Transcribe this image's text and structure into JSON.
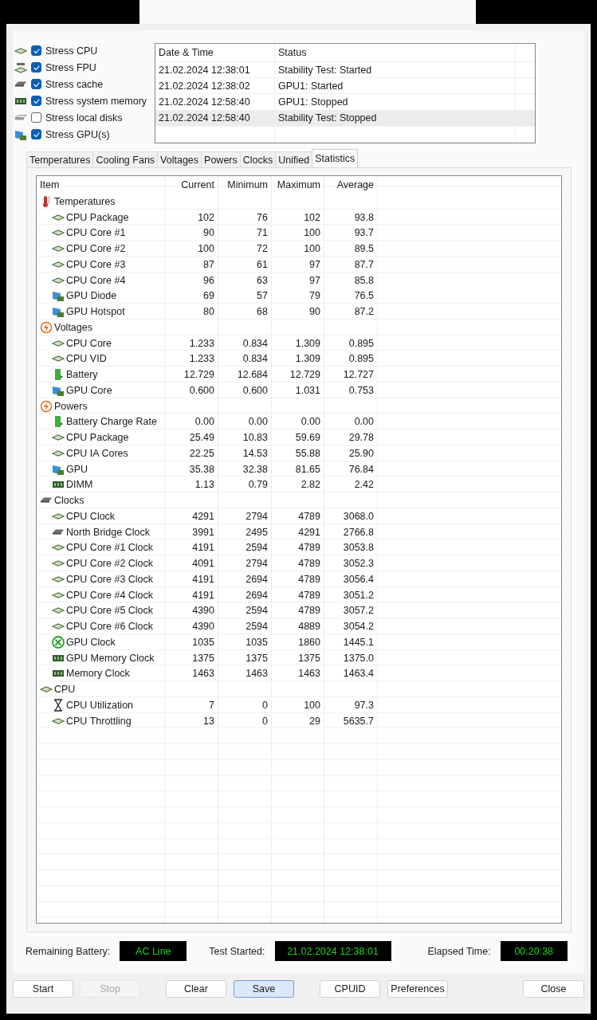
{
  "stress_options": [
    {
      "label": "Stress CPU",
      "checked": true,
      "kind": "cpu"
    },
    {
      "label": "Stress FPU",
      "checked": true,
      "kind": "fpu"
    },
    {
      "label": "Stress cache",
      "checked": true,
      "kind": "cache"
    },
    {
      "label": "Stress system memory",
      "checked": true,
      "kind": "dimm"
    },
    {
      "label": "Stress local disks",
      "checked": false,
      "kind": "disk"
    },
    {
      "label": "Stress GPU(s)",
      "checked": true,
      "kind": "gpu"
    }
  ],
  "log": {
    "columns": [
      "Date & Time",
      "Status"
    ],
    "rows": [
      {
        "time": "21.02.2024 12:38:01",
        "status": "Stability Test: Started",
        "selected": false
      },
      {
        "time": "21.02.2024 12:38:02",
        "status": "GPU1: Started",
        "selected": false
      },
      {
        "time": "21.02.2024 12:58:40",
        "status": "GPU1: Stopped",
        "selected": false
      },
      {
        "time": "21.02.2024 12:58:40",
        "status": "Stability Test: Stopped",
        "selected": true
      }
    ]
  },
  "tabs": [
    {
      "label": "Temperatures",
      "selected": false
    },
    {
      "label": "Cooling Fans",
      "selected": false
    },
    {
      "label": "Voltages",
      "selected": false
    },
    {
      "label": "Powers",
      "selected": false
    },
    {
      "label": "Clocks",
      "selected": false
    },
    {
      "label": "Unified",
      "selected": false
    },
    {
      "label": "Statistics",
      "selected": true
    }
  ],
  "statistics": {
    "columns": [
      "Item",
      "Current",
      "Minimum",
      "Maximum",
      "Average"
    ],
    "groups": [
      {
        "name": "Temperatures",
        "kind": "thermometer",
        "children": [
          {
            "name": "CPU Package",
            "kind": "cpu",
            "values": [
              "102",
              "76",
              "102",
              "93.8"
            ]
          },
          {
            "name": "CPU Core #1",
            "kind": "cpu",
            "values": [
              "90",
              "71",
              "100",
              "93.7"
            ]
          },
          {
            "name": "CPU Core #2",
            "kind": "cpu",
            "values": [
              "100",
              "72",
              "100",
              "89.5"
            ]
          },
          {
            "name": "CPU Core #3",
            "kind": "cpu",
            "values": [
              "87",
              "61",
              "97",
              "87.7"
            ]
          },
          {
            "name": "CPU Core #4",
            "kind": "cpu",
            "values": [
              "96",
              "63",
              "97",
              "85.8"
            ]
          },
          {
            "name": "GPU Diode",
            "kind": "gpu",
            "values": [
              "69",
              "57",
              "79",
              "76.5"
            ]
          },
          {
            "name": "GPU Hotspot",
            "kind": "gpu",
            "values": [
              "80",
              "68",
              "90",
              "87.2"
            ]
          }
        ]
      },
      {
        "name": "Voltages",
        "kind": "bolt",
        "children": [
          {
            "name": "CPU Core",
            "kind": "cpu",
            "values": [
              "1.233",
              "0.834",
              "1.309",
              "0.895"
            ]
          },
          {
            "name": "CPU VID",
            "kind": "cpu",
            "values": [
              "1.233",
              "0.834",
              "1.309",
              "0.895"
            ]
          },
          {
            "name": "Battery",
            "kind": "battery",
            "values": [
              "12.729",
              "12.684",
              "12.729",
              "12.727"
            ]
          },
          {
            "name": "GPU Core",
            "kind": "gpu",
            "values": [
              "0.600",
              "0.600",
              "1.031",
              "0.753"
            ]
          }
        ]
      },
      {
        "name": "Powers",
        "kind": "bolt",
        "children": [
          {
            "name": "Battery Charge Rate",
            "kind": "battery",
            "values": [
              "0.00",
              "0.00",
              "0.00",
              "0.00"
            ]
          },
          {
            "name": "CPU Package",
            "kind": "cpu",
            "values": [
              "25.49",
              "10.83",
              "59.69",
              "29.78"
            ]
          },
          {
            "name": "CPU IA Cores",
            "kind": "cpu",
            "values": [
              "22.25",
              "14.53",
              "55.88",
              "25.90"
            ]
          },
          {
            "name": "GPU",
            "kind": "gpu",
            "values": [
              "35.38",
              "32.38",
              "81.65",
              "76.84"
            ]
          },
          {
            "name": "DIMM",
            "kind": "dimm",
            "values": [
              "1.13",
              "0.79",
              "2.82",
              "2.42"
            ]
          }
        ]
      },
      {
        "name": "Clocks",
        "kind": "cache",
        "children": [
          {
            "name": "CPU Clock",
            "kind": "cpu",
            "values": [
              "4291",
              "2794",
              "4789",
              "3068.0"
            ]
          },
          {
            "name": "North Bridge Clock",
            "kind": "cache",
            "values": [
              "3991",
              "2495",
              "4291",
              "2766.8"
            ]
          },
          {
            "name": "CPU Core #1 Clock",
            "kind": "cpu",
            "values": [
              "4191",
              "2594",
              "4789",
              "3053.8"
            ]
          },
          {
            "name": "CPU Core #2 Clock",
            "kind": "cpu",
            "values": [
              "4091",
              "2794",
              "4789",
              "3052.3"
            ]
          },
          {
            "name": "CPU Core #3 Clock",
            "kind": "cpu",
            "values": [
              "4191",
              "2694",
              "4789",
              "3056.4"
            ]
          },
          {
            "name": "CPU Core #4 Clock",
            "kind": "cpu",
            "values": [
              "4191",
              "2694",
              "4789",
              "3051.2"
            ]
          },
          {
            "name": "CPU Core #5 Clock",
            "kind": "cpu",
            "values": [
              "4390",
              "2594",
              "4789",
              "3057.2"
            ]
          },
          {
            "name": "CPU Core #6 Clock",
            "kind": "cpu",
            "values": [
              "4390",
              "2594",
              "4889",
              "3054.2"
            ]
          },
          {
            "name": "GPU Clock",
            "kind": "xcircle",
            "values": [
              "1035",
              "1035",
              "1860",
              "1445.1"
            ]
          },
          {
            "name": "GPU Memory Clock",
            "kind": "dimm",
            "values": [
              "1375",
              "1375",
              "1375",
              "1375.0"
            ]
          },
          {
            "name": "Memory Clock",
            "kind": "dimm",
            "values": [
              "1463",
              "1463",
              "1463",
              "1463.4"
            ]
          }
        ]
      },
      {
        "name": "CPU",
        "kind": "cpu",
        "children": [
          {
            "name": "CPU Utilization",
            "kind": "hourglass",
            "values": [
              "7",
              "0",
              "100",
              "97.3"
            ]
          },
          {
            "name": "CPU Throttling",
            "kind": "cpu",
            "values": [
              "13",
              "0",
              "29",
              "5635.7"
            ]
          }
        ]
      }
    ]
  },
  "status": [
    {
      "label": "Remaining Battery:",
      "value": "AC Line"
    },
    {
      "label": "Test Started:",
      "value": "21.02.2024 12:38:01"
    },
    {
      "label": "Elapsed Time:",
      "value": "00:20:38"
    }
  ],
  "buttons": [
    {
      "label": "Start",
      "disabled": false,
      "default": false
    },
    {
      "label": "Stop",
      "disabled": true,
      "default": false
    },
    {
      "label": "Clear",
      "disabled": false,
      "default": false
    },
    {
      "label": "Save",
      "disabled": false,
      "default": true
    },
    {
      "label": "CPUID",
      "disabled": false,
      "default": false
    },
    {
      "label": "Preferences",
      "disabled": false,
      "default": false
    },
    {
      "label": "Close",
      "disabled": false,
      "default": false
    }
  ]
}
